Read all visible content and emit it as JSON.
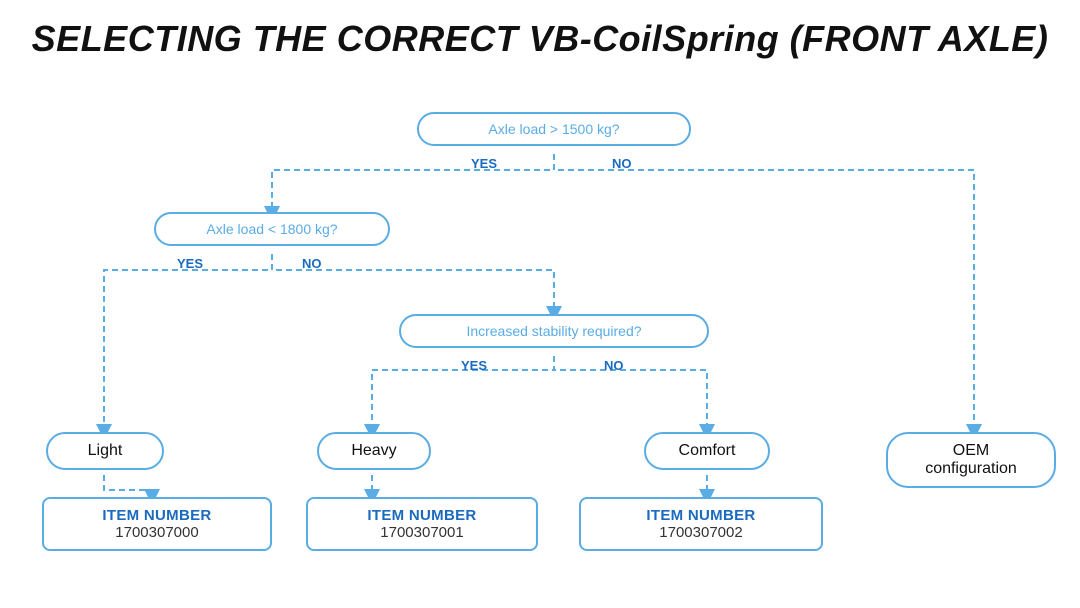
{
  "title": "SELECTING THE CORRECT VB-CoilSpring (FRONT AXLE)",
  "decisions": [
    {
      "id": "d1",
      "text": "Axle load > 1500 kg?",
      "yes_label": "YES",
      "no_label": "NO"
    },
    {
      "id": "d2",
      "text": "Axle load < 1800 kg?",
      "yes_label": "YES",
      "no_label": "NO"
    },
    {
      "id": "d3",
      "text": "Increased stability required?",
      "yes_label": "YES",
      "no_label": "NO"
    }
  ],
  "results": [
    {
      "id": "r1",
      "text": "Light"
    },
    {
      "id": "r2",
      "text": "Heavy"
    },
    {
      "id": "r3",
      "text": "Comfort"
    },
    {
      "id": "r4",
      "text": "OEM configuration"
    }
  ],
  "items": [
    {
      "id": "i1",
      "label": "ITEM NUMBER",
      "number": "1700307000"
    },
    {
      "id": "i2",
      "label": "ITEM NUMBER",
      "number": "1700307001"
    },
    {
      "id": "i3",
      "label": "ITEM NUMBER",
      "number": "1700307002"
    }
  ]
}
